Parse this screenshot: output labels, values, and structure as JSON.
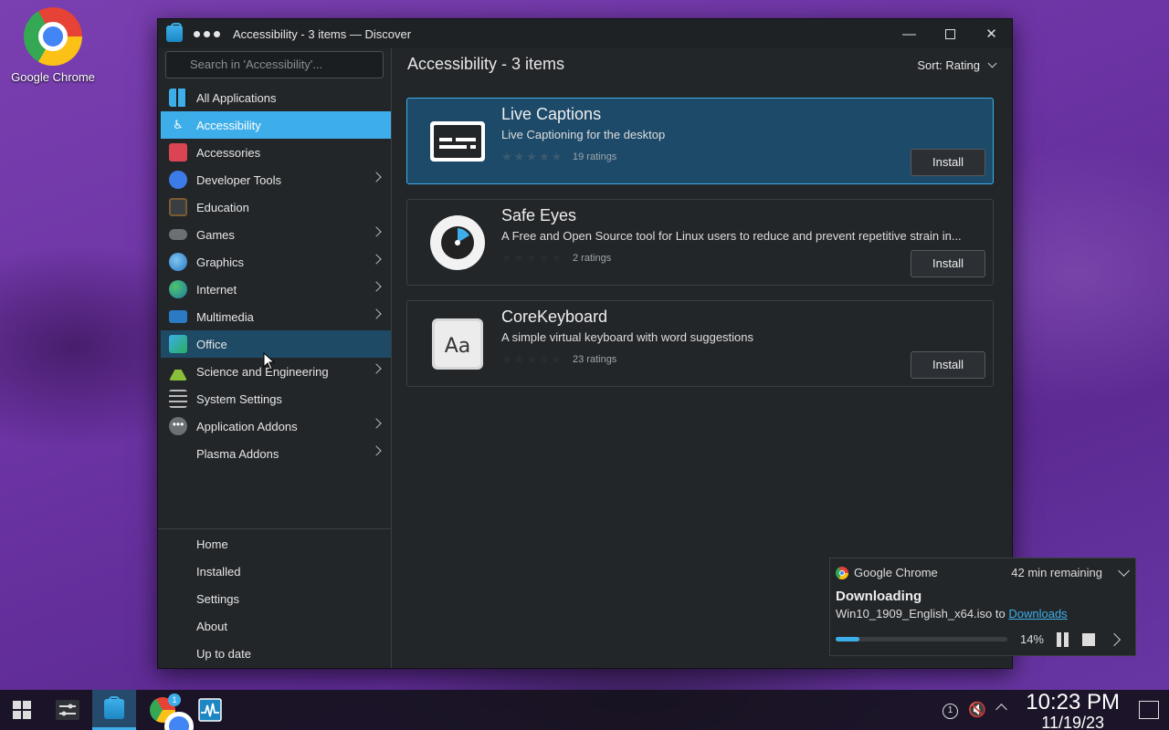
{
  "desktop": {
    "icon_label": "Google Chrome"
  },
  "window": {
    "title": "Accessibility - 3 items — Discover"
  },
  "sidebar": {
    "search_placeholder": "Search in 'Accessibility'...",
    "categories": [
      {
        "label": "All Applications"
      },
      {
        "label": "Accessibility"
      },
      {
        "label": "Accessories"
      },
      {
        "label": "Developer Tools"
      },
      {
        "label": "Education"
      },
      {
        "label": "Games"
      },
      {
        "label": "Graphics"
      },
      {
        "label": "Internet"
      },
      {
        "label": "Multimedia"
      },
      {
        "label": "Office"
      },
      {
        "label": "Science and Engineering"
      },
      {
        "label": "System Settings"
      },
      {
        "label": "Application Addons"
      },
      {
        "label": "Plasma Addons"
      }
    ],
    "nav": [
      {
        "label": "Home"
      },
      {
        "label": "Installed"
      },
      {
        "label": "Settings"
      },
      {
        "label": "About"
      },
      {
        "label": "Up to date"
      }
    ]
  },
  "main": {
    "title": "Accessibility - 3 items",
    "sort_label": "Sort: Rating",
    "apps": [
      {
        "name": "Live Captions",
        "desc": "Live Captioning for the desktop",
        "ratings": "19 ratings",
        "stars": "★★★★★",
        "action": "Install"
      },
      {
        "name": "Safe Eyes",
        "desc": "A Free and Open Source tool for Linux users to reduce and prevent repetitive strain in...",
        "ratings": "2 ratings",
        "stars": "★★★★★",
        "action": "Install"
      },
      {
        "name": "CoreKeyboard",
        "desc": "A simple virtual keyboard with word suggestions",
        "ratings": "23 ratings",
        "stars": "★★★★★",
        "action": "Install"
      }
    ]
  },
  "notification": {
    "app": "Google Chrome",
    "time_remaining": "42 min remaining",
    "title": "Downloading",
    "file": "Win10_1909_English_x64.iso to ",
    "link": "Downloads",
    "percent": "14%",
    "progress": 0.14
  },
  "taskbar": {
    "chrome_badge": "1",
    "time": "10:23 PM",
    "date": "11/19/23"
  },
  "colors": {
    "accent": "#3daee9",
    "window_bg": "#232629"
  }
}
